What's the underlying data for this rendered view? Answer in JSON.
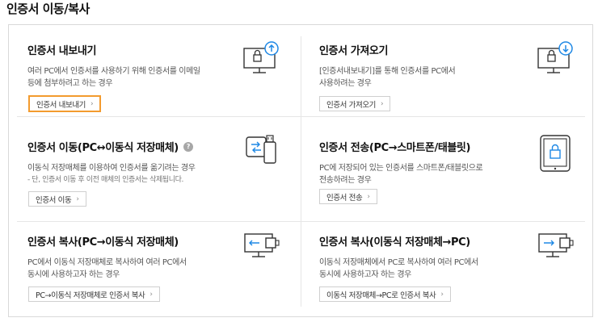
{
  "page": {
    "title": "인증서 이동/복사"
  },
  "colors": {
    "accent": "#1e88e5",
    "highlight": "#f39b2e",
    "border": "#d9d9d9"
  },
  "cards": {
    "export": {
      "title": "인증서 내보내기",
      "desc": [
        "여러 PC에서 인증서를 사용하기 위해 인증서를 이메일",
        "등에 첨부하려고 하는 경우"
      ],
      "button": "인증서 내보내기",
      "icon": "monitor-upload-icon"
    },
    "import": {
      "title": "인증서 가져오기",
      "desc": [
        "[인증서내보내기]를 통해 인증서를 PC에서",
        "사용하려는 경우"
      ],
      "button": "인증서 가져오기",
      "icon": "monitor-download-icon"
    },
    "move": {
      "title": "인증서 이동(PC↔이동식 저장매체)",
      "help": "?",
      "desc": [
        "이동식 저장매체를 이용하여 인증서를 옮기려는 경우"
      ],
      "note": "- 단, 인증서 이동 후 이전 매체의 인증서는 삭제됩니다.",
      "button": "인증서 이동",
      "icon": "pc-usb-transfer-icon"
    },
    "send": {
      "title": "인증서 전송(PC→스마트폰/태블릿)",
      "desc": [
        "PC에 저장되어 있는 인증서를 스마트폰/태블릿으로",
        "전송하려는 경우"
      ],
      "button": "인증서 전송",
      "icon": "smartphone-lock-icon"
    },
    "copy_to_media": {
      "title": "인증서 복사(PC→이동식 저장매체)",
      "desc": [
        "PC에서 이동식 저장매체로 복사하여 여러 PC에서",
        "동시에 사용하고자 하는 경우"
      ],
      "button": "PC→이동식 저장매체로 인증서 복사",
      "icon": "monitor-copy-left-icon"
    },
    "copy_to_pc": {
      "title": "인증서 복사(이동식 저장매체→PC)",
      "desc": [
        "이동식 저장매체에서 PC로 복사하여 여러 PC에서",
        "동시에 사용하고자 하는 경우"
      ],
      "button": "이동식 저장매체→PC로 인증서 복사",
      "icon": "monitor-copy-right-icon"
    }
  }
}
